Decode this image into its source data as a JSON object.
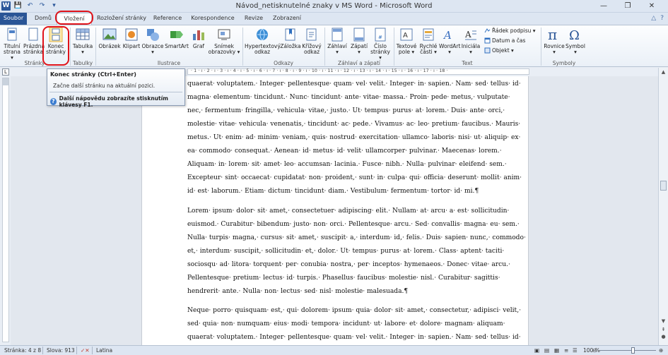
{
  "window": {
    "title": "Návod_netisknutelné znaky v MS Word  -  Microsoft Word",
    "minimize": "—",
    "restore": "❐",
    "close": "✕"
  },
  "qat": {
    "word": "W",
    "save": "💾",
    "undo": "↶",
    "redo": "↷",
    "customize": "▾"
  },
  "tabs": [
    {
      "label": "Soubor"
    },
    {
      "label": "Domů"
    },
    {
      "label": "Vložení"
    },
    {
      "label": "Rozložení stránky"
    },
    {
      "label": "Reference"
    },
    {
      "label": "Korespondence"
    },
    {
      "label": "Revize"
    },
    {
      "label": "Zobrazení"
    }
  ],
  "ribbon": {
    "groups": {
      "stranky": "Stránky",
      "tabulky": "Tabulky",
      "ilustrace": "Ilustrace",
      "odkazy": "Odkazy",
      "zahlavi": "Záhlaví a zápatí",
      "text": "Text",
      "symboly": "Symboly"
    },
    "buttons": {
      "titulni": [
        "Titulní",
        "strana ▾"
      ],
      "prazdna": [
        "Prázdná",
        "stránka"
      ],
      "konec": [
        "Konec",
        "stránky"
      ],
      "tabulka": [
        "Tabulka",
        "▾"
      ],
      "obrazek": [
        "Obrázek",
        ""
      ],
      "klipart": [
        "Klipart",
        ""
      ],
      "obrazce": [
        "Obrazce",
        "▾"
      ],
      "smartart": [
        "SmartArt",
        ""
      ],
      "graf": [
        "Graf",
        ""
      ],
      "snimek": [
        "Snímek",
        "obrazovky ▾"
      ],
      "hypertext": [
        "Hypertextový",
        "odkaz"
      ],
      "zalozka": [
        "Záložka",
        ""
      ],
      "krizovy": [
        "Křížový",
        "odkaz"
      ],
      "zahlavi_btn": [
        "Záhlaví",
        "▾"
      ],
      "zapati": [
        "Zápatí",
        "▾"
      ],
      "cislo": [
        "Číslo",
        "stránky ▾"
      ],
      "textove": [
        "Textové",
        "pole ▾"
      ],
      "rychle": [
        "Rychlé",
        "části ▾"
      ],
      "wordart": [
        "WordArt",
        "▾"
      ],
      "inicala": [
        "Iniciála",
        "▾"
      ],
      "rovnice": [
        "Rovnice",
        "▾"
      ],
      "symbol": [
        "Symbol",
        "▾"
      ]
    },
    "small": {
      "radek_podpisu": "Řádek podpisu ▾",
      "datum": "Datum a čas",
      "objekt": "Objekt ▾"
    }
  },
  "ruler": {
    "numbers": "· 1 · ı · 2 · ı · 3 · ı · 4 · ı · 5 · ı · 6 · ı · 7 · ı · 8 · ı · 9 · ı · 10 · ı · 11 · ı · 12 · ı · 13 · ı · 14 · ı · 15 · ı · 16 · ı · 17 · ı · 18 ·",
    "corner": "L"
  },
  "tooltip": {
    "title": "Konec stránky (Ctrl+Enter)",
    "description": "Začne další stránku na aktuální pozici.",
    "help": "Další nápovědu zobrazíte stisknutím klávesy F1."
  },
  "document": {
    "para1": [
      "quaerat· voluptatem.· Integer· pellentesque· quam· vel· velit.· Integer· in· sapien.· Nam· sed· tellus· id·",
      "magna· elementum· tincidunt.· Nunc· tincidunt· ante· vitae· massa.· Proin· pede· metus,· vulputate·",
      "nec,· fermentum· fringilla,· vehicula· vitae,· justo.· Ut· tempus· purus· at· lorem.· Duis· ante· orci,·",
      "molestie· vitae· vehicula· venenatis,· tincidunt· ac· pede.· Vivamus· ac· leo· pretium· faucibus.· Mauris·",
      "metus.· Ut· enim· ad· minim· veniam,· quis· nostrud· exercitation· ullamco· laboris· nisi· ut· aliquip· ex·",
      "ea· commodo· consequat.· Aenean· id· metus· id· velit· ullamcorper· pulvinar.· Maecenas· lorem.·",
      "Aliquam· in· lorem· sit· amet· leo· accumsan· lacinia.· Fusce· nibh.· Nulla· pulvinar· eleifend· sem.·",
      "Excepteur· sint· occaecat· cupidatat· non· proident,· sunt· in· culpa· qui· officia· deserunt· mollit· anim·",
      "id· est· laborum.· Etiam· dictum· tincidunt· diam.· Vestibulum· fermentum· tortor· id· mi.¶"
    ],
    "para2": [
      "Lorem· ipsum· dolor· sit· amet,· consectetuer· adipiscing· elit.· Nullam· at· arcu· a· est· sollicitudin·",
      "euismod.· Curabitur· bibendum· justo· non· orci.· Pellentesque· arcu.· Sed· convallis· magna· eu· sem.·",
      "Nulla· turpis· magna,· cursus· sit· amet,· suscipit· a,· interdum· id,· felis.· Duis· sapien· nunc,· commodo·",
      "et,· interdum· suscipit,· sollicitudin· et,· dolor.· Ut· tempus· purus· at· lorem.· Class· aptent· taciti·",
      "sociosqu· ad· litora· torquent· per· conubia· nostra,· per· inceptos· hymenaeos.· Donec· vitae· arcu.·",
      "Pellentesque· pretium· lectus· id· turpis.· Phasellus· faucibus· molestie· nisl.· Curabitur· sagittis·",
      "hendrerit· ante.· Nulla· non· lectus· sed· nisl· molestie· malesuada.¶"
    ],
    "para3": [
      "Neque· porro· quisquam· est,· qui· dolorem· ipsum· quia· dolor· sit· amet,· consectetur,· adipisci· velit,·",
      "sed· quia· non· numquam· eius· modi· tempora· incidunt· ut· labore· et· dolore· magnam· aliquam·",
      "quaerat· voluptatem.· Integer· pellentesque· quam· vel· velit.· Integer· in· sapien.· Nam· sed· tellus· id·"
    ]
  },
  "status": {
    "page": "Stránka: 4 z 8",
    "words": "Slova: 913",
    "language": "Latina",
    "zoom": "100 %",
    "zoom_minus": "⊖",
    "zoom_plus": "⊕"
  },
  "colors": {
    "file_tab": "#2a5596",
    "highlight": "#e0131a",
    "page_bg": "#ffffff"
  }
}
